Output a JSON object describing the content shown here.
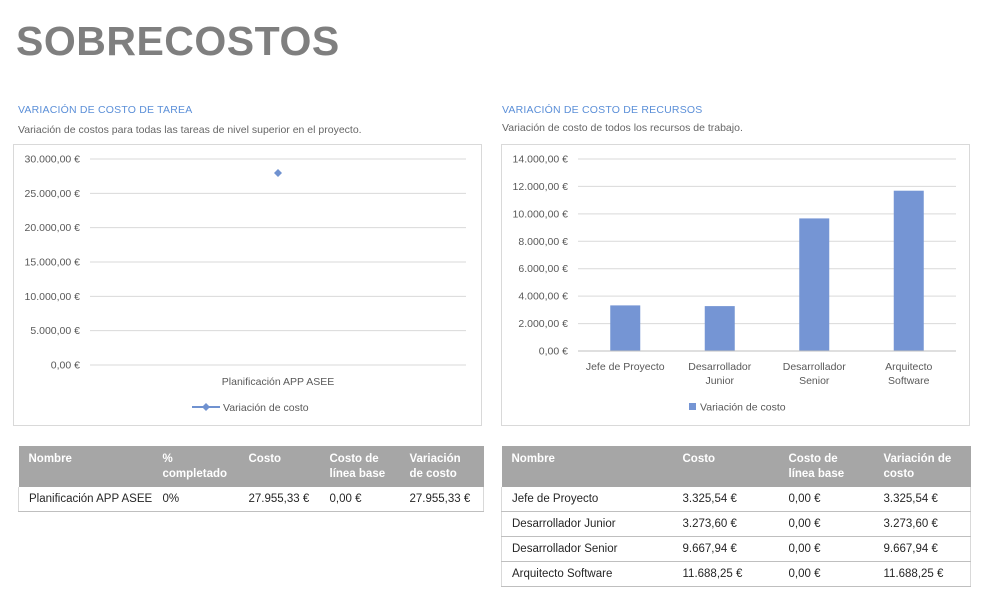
{
  "page_title": "SOBRECOSTOS",
  "task_section": {
    "title": "VARIACIÓN DE COSTO DE TAREA",
    "subtitle": "Variación de costos para todas las tareas de nivel superior en el proyecto."
  },
  "resource_section": {
    "title": "VARIACIÓN DE COSTO DE RECURSOS",
    "subtitle": "Variación de costo de todos los recursos de trabajo."
  },
  "chart_data": [
    {
      "type": "line",
      "categories": [
        "Planificación APP ASEE"
      ],
      "series": [
        {
          "name": "Variación de costo",
          "values": [
            27955.33
          ],
          "color": "#7092d0"
        }
      ],
      "ylim": [
        0,
        30000
      ],
      "yticks": [
        0,
        5000,
        10000,
        15000,
        20000,
        25000,
        30000
      ],
      "ytick_labels": [
        "0,00 €",
        "5.000,00 €",
        "10.000,00 €",
        "15.000,00 €",
        "20.000,00 €",
        "25.000,00 €",
        "30.000,00 €"
      ],
      "grid": true,
      "legend": "bottom",
      "marker": "diamond"
    },
    {
      "type": "bar",
      "categories": [
        "Jefe de Proyecto",
        "Desarrollador Junior",
        "Desarrollador Senior",
        "Arquitecto Software"
      ],
      "category_lines": [
        [
          "Jefe de Proyecto"
        ],
        [
          "Desarrollador",
          "Junior"
        ],
        [
          "Desarrollador",
          "Senior"
        ],
        [
          "Arquitecto",
          "Software"
        ]
      ],
      "series": [
        {
          "name": "Variación de costo",
          "values": [
            3325.54,
            3273.6,
            9667.94,
            11688.25
          ],
          "color": "#7595d4"
        }
      ],
      "ylim": [
        0,
        14000
      ],
      "yticks": [
        0,
        2000,
        4000,
        6000,
        8000,
        10000,
        12000,
        14000
      ],
      "ytick_labels": [
        "0,00 €",
        "2.000,00 €",
        "4.000,00 €",
        "6.000,00 €",
        "8.000,00 €",
        "10.000,00 €",
        "12.000,00 €",
        "14.000,00 €"
      ],
      "grid": true,
      "legend": "bottom"
    }
  ],
  "task_table": {
    "headers": [
      "Nombre",
      "% completado",
      "Costo",
      "Costo de línea base",
      "Variación de costo"
    ],
    "rows": [
      [
        "Planificación APP ASEE",
        "0%",
        "27.955,33 €",
        "0,00 €",
        "27.955,33 €"
      ]
    ]
  },
  "resource_table": {
    "headers": [
      "Nombre",
      "Costo",
      "Costo de línea base",
      "Variación de costo"
    ],
    "rows": [
      [
        "Jefe de Proyecto",
        "3.325,54 €",
        "0,00 €",
        "3.325,54 €"
      ],
      [
        "Desarrollador Junior",
        "3.273,60 €",
        "0,00 €",
        "3.273,60 €"
      ],
      [
        "Desarrollador Senior",
        "9.667,94 €",
        "0,00 €",
        "9.667,94 €"
      ],
      [
        "Arquitecto Software",
        "11.688,25 €",
        "0,00 €",
        "11.688,25 €"
      ]
    ]
  },
  "colors": {
    "header_bg": "#a6a6a6",
    "accent": "#5b8fd8",
    "series": "#7595d4",
    "title": "#7f7f7f"
  }
}
